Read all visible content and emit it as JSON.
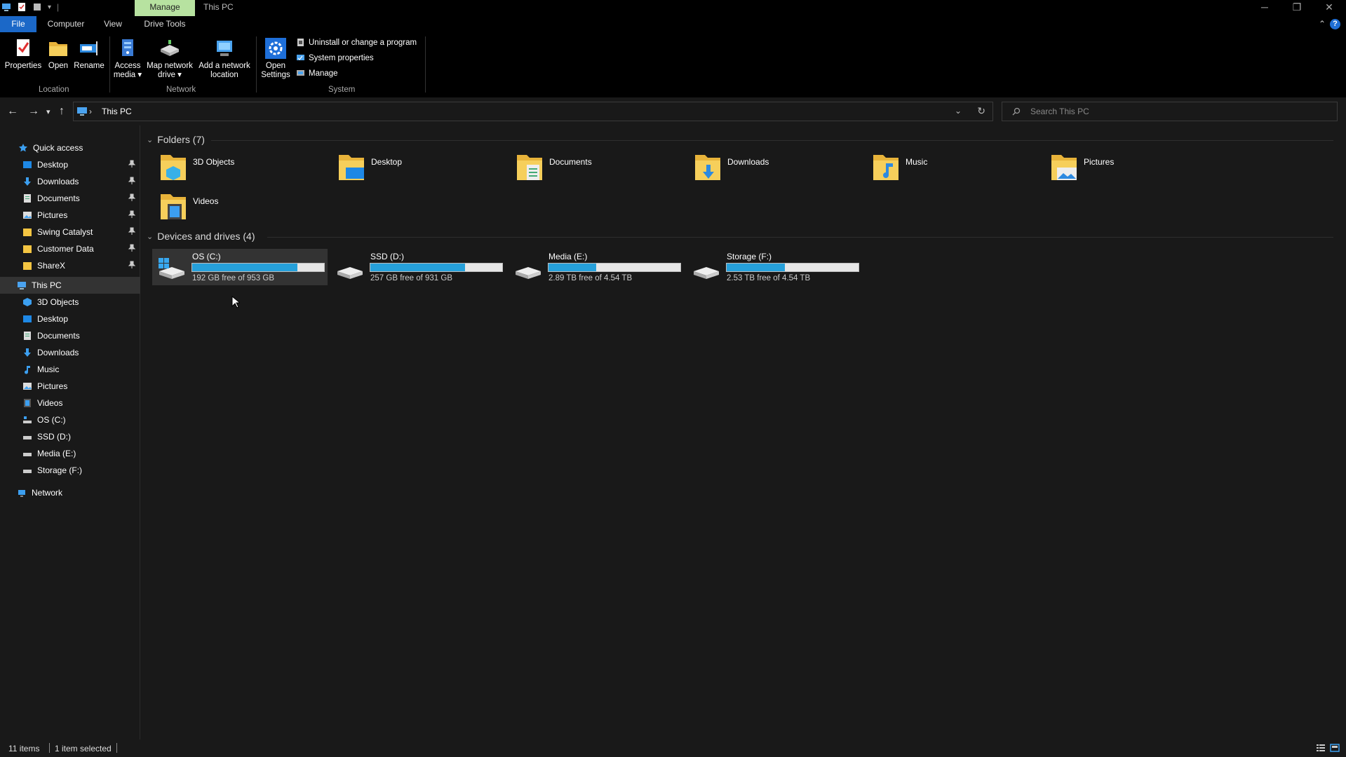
{
  "titlebar": {
    "context_tab": "Manage",
    "window_title": "This PC"
  },
  "menubar": {
    "file": "File",
    "computer": "Computer",
    "view": "View",
    "drive_tools": "Drive Tools"
  },
  "ribbon": {
    "location": {
      "label": "Location",
      "properties": "Properties",
      "open": "Open",
      "rename": "Rename"
    },
    "network": {
      "label": "Network",
      "access_media_1": "Access",
      "access_media_2": "media",
      "map_drive_1": "Map network",
      "map_drive_2": "drive",
      "add_location_1": "Add a network",
      "add_location_2": "location"
    },
    "system": {
      "label": "System",
      "open_settings_1": "Open",
      "open_settings_2": "Settings",
      "uninstall": "Uninstall or change a program",
      "system_properties": "System properties",
      "manage": "Manage"
    }
  },
  "address": {
    "path": "This PC",
    "search_placeholder": "Search This PC"
  },
  "sidebar": {
    "quick_access": "Quick access",
    "quick_items": [
      {
        "label": "Desktop"
      },
      {
        "label": "Downloads"
      },
      {
        "label": "Documents"
      },
      {
        "label": "Pictures"
      },
      {
        "label": "Swing Catalyst"
      },
      {
        "label": "Customer Data"
      },
      {
        "label": "ShareX"
      }
    ],
    "this_pc": "This PC",
    "pc_items": [
      {
        "label": "3D Objects"
      },
      {
        "label": "Desktop"
      },
      {
        "label": "Documents"
      },
      {
        "label": "Downloads"
      },
      {
        "label": "Music"
      },
      {
        "label": "Pictures"
      },
      {
        "label": "Videos"
      },
      {
        "label": "OS (C:)"
      },
      {
        "label": "SSD (D:)"
      },
      {
        "label": "Media (E:)"
      },
      {
        "label": "Storage (F:)"
      }
    ],
    "network": "Network"
  },
  "content": {
    "folders_header": "Folders (7)",
    "folders": [
      {
        "label": "3D Objects"
      },
      {
        "label": "Desktop"
      },
      {
        "label": "Documents"
      },
      {
        "label": "Downloads"
      },
      {
        "label": "Music"
      },
      {
        "label": "Pictures"
      },
      {
        "label": "Videos"
      }
    ],
    "drives_header": "Devices and drives (4)",
    "drives": [
      {
        "name": "OS (C:)",
        "free": "192 GB free of 953 GB",
        "used_fraction": 0.8
      },
      {
        "name": "SSD (D:)",
        "free": "257 GB free of 931 GB",
        "used_fraction": 0.72
      },
      {
        "name": "Media (E:)",
        "free": "2.89 TB free of 4.54 TB",
        "used_fraction": 0.36
      },
      {
        "name": "Storage (F:)",
        "free": "2.53 TB free of 4.54 TB",
        "used_fraction": 0.44
      }
    ]
  },
  "status": {
    "items": "11 items",
    "selected": "1 item selected"
  },
  "colors": {
    "accent": "#1b68c8",
    "manage_tab": "#b7e2a0",
    "drive_bar": "#26a0da",
    "folder_yellow": "#f4c542"
  }
}
